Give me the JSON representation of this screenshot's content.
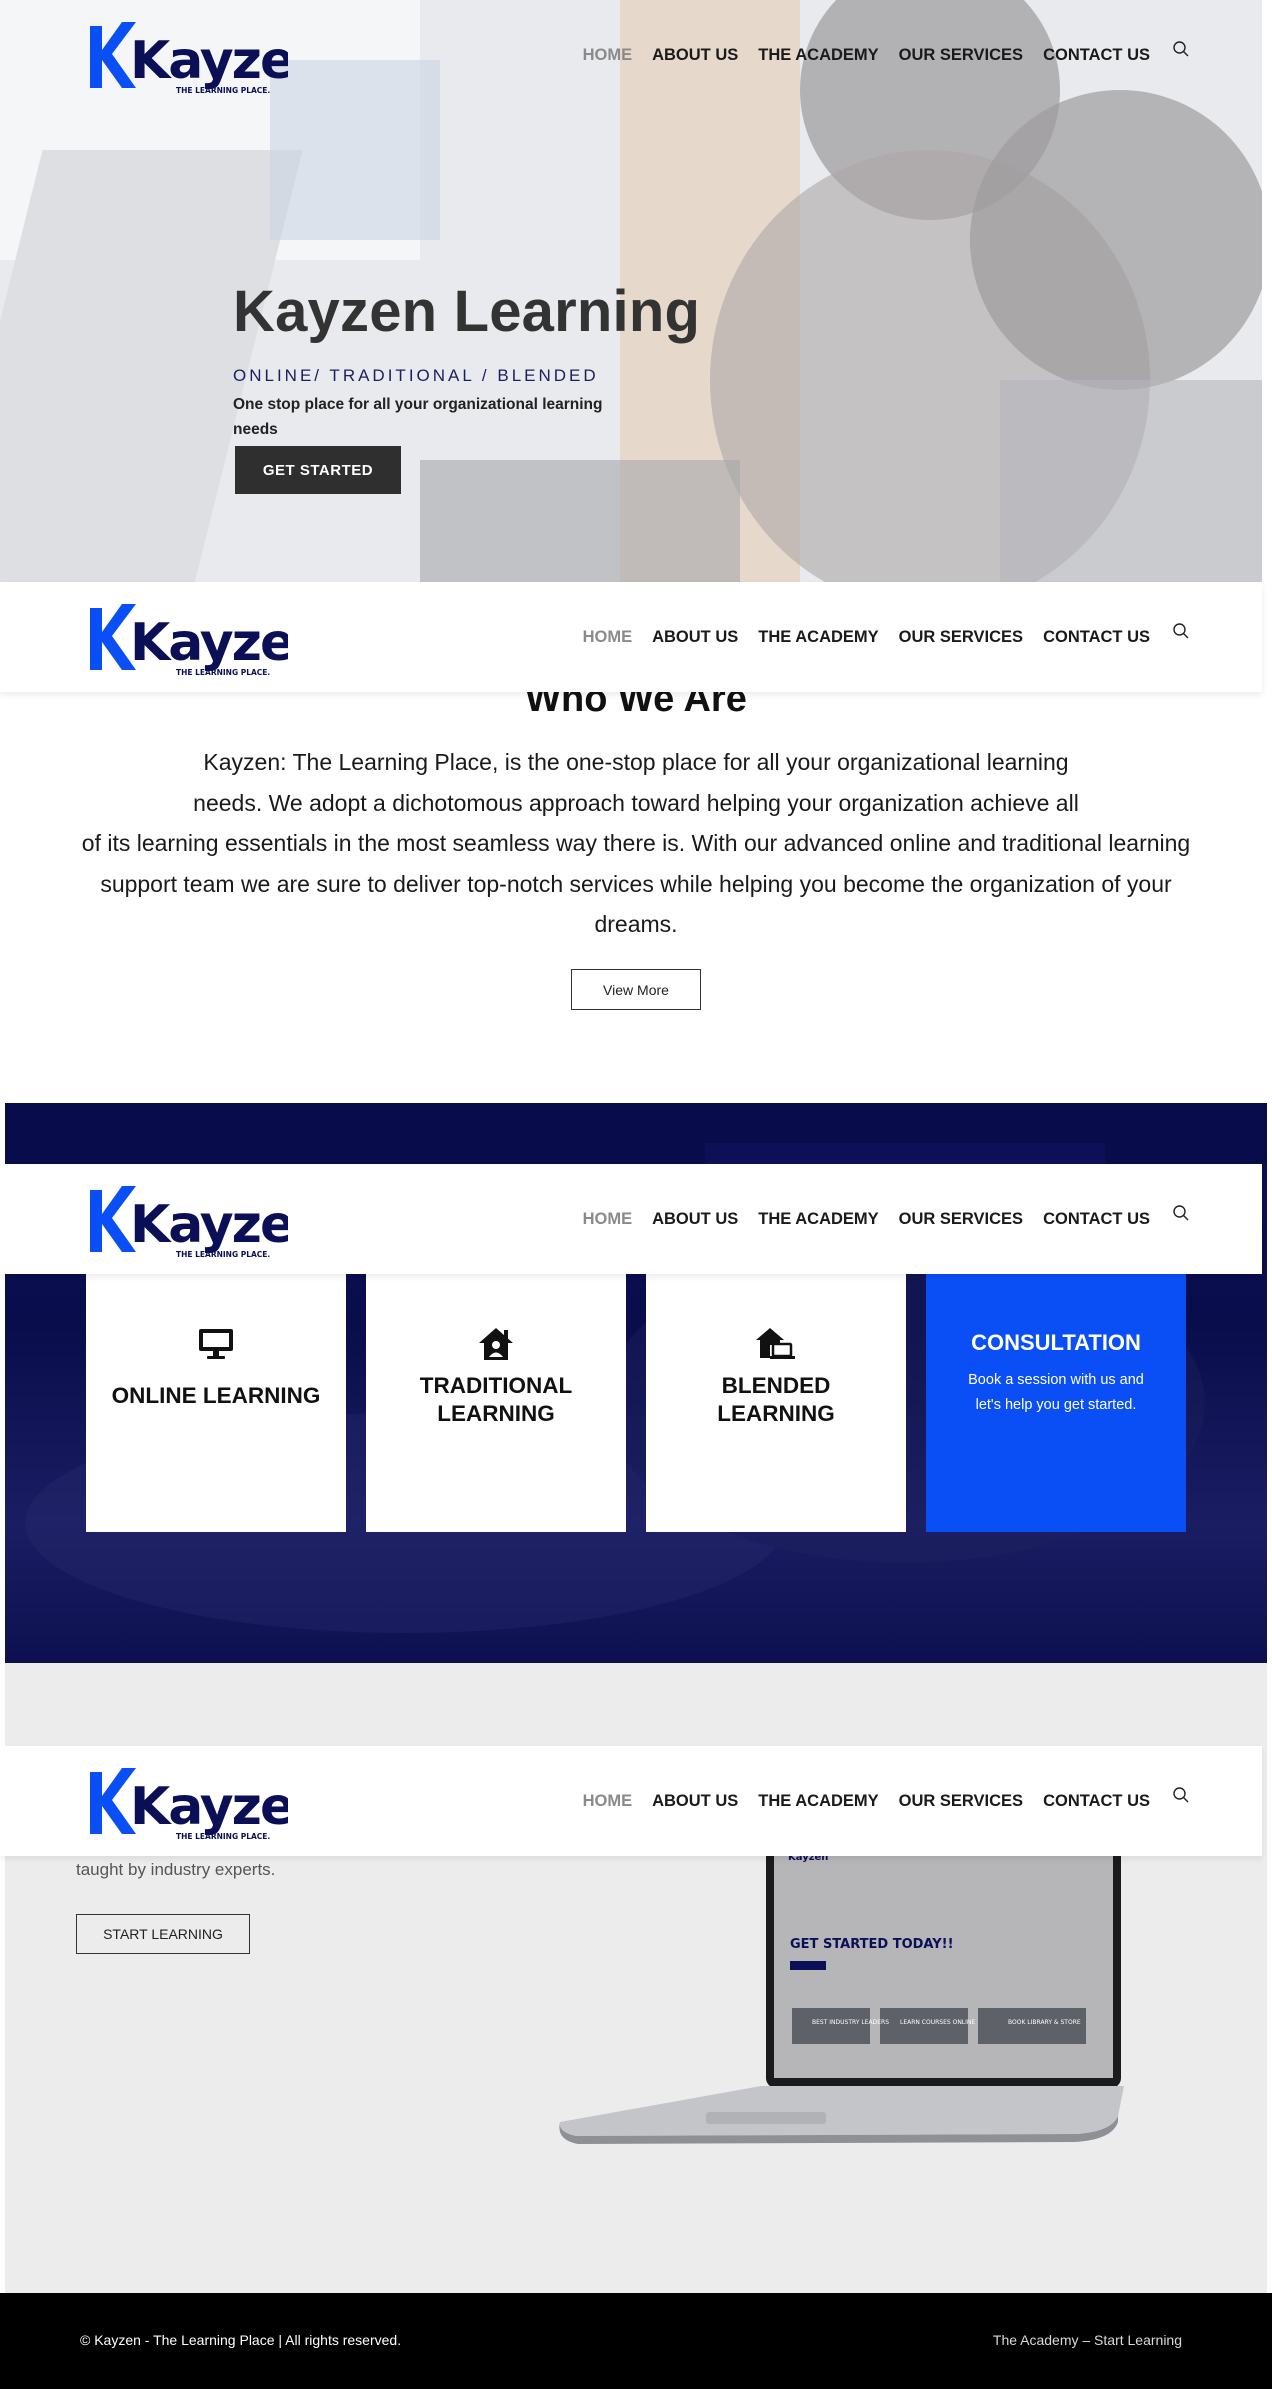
{
  "brand": {
    "name": "Kayzen",
    "tagline": "THE LEARNING PLACE.",
    "logo_blue": "#0a4ff5",
    "logo_navy": "#0b0f55"
  },
  "nav": {
    "items": [
      "HOME",
      "ABOUT US",
      "THE ACADEMY",
      "OUR SERVICES",
      "CONTACT US"
    ],
    "active": "HOME",
    "search_icon": "search-icon"
  },
  "hero": {
    "title": "Kayzen Learning",
    "subtitle": "ONLINE/ TRADITIONAL / BLENDED",
    "description": "One stop place for all your organizational learning needs",
    "button": "GET STARTED"
  },
  "about": {
    "title": "Who We Are",
    "lines": [
      "Kayzen: The Learning Place, is the one-stop place for all your organizational learning",
      "needs. We adopt a dichotomous approach toward helping your organization achieve all",
      "of its learning essentials in the most seamless way there is. With our advanced online and traditional learning",
      "support team we are sure to deliver top-notch services while helping you become the organization of your",
      "dreams."
    ],
    "button": "View More"
  },
  "services": {
    "cards": [
      {
        "icon": "desktop-icon",
        "label": "ONLINE LEARNING"
      },
      {
        "icon": "house-user-icon",
        "label_line1": "TRADITIONAL",
        "label_line2": "LEARNING"
      },
      {
        "icon": "house-laptop-icon",
        "label_line1": "BLENDED",
        "label_line2": "LEARNING"
      }
    ],
    "consultation": {
      "title": "CONSULTATION",
      "line1": "Book a session with us and",
      "line2": "let's help you get started."
    },
    "accent": "#0a4ff5",
    "band_color": "#0b0f55"
  },
  "learning": {
    "text": "taught by industry experts.",
    "button": "START LEARNING",
    "screen": {
      "logo": "Kayzen",
      "headline": "GET STARTED TODAY!!",
      "tiles": [
        "BEST INDUSTRY LEADERS",
        "LEARN COURSES ONLINE",
        "BOOK LIBRARY & STORE"
      ]
    }
  },
  "footer": {
    "copyright": "© Kayzen - The Learning Place | All rights reserved.",
    "link": "The Academy – Start Learning"
  }
}
